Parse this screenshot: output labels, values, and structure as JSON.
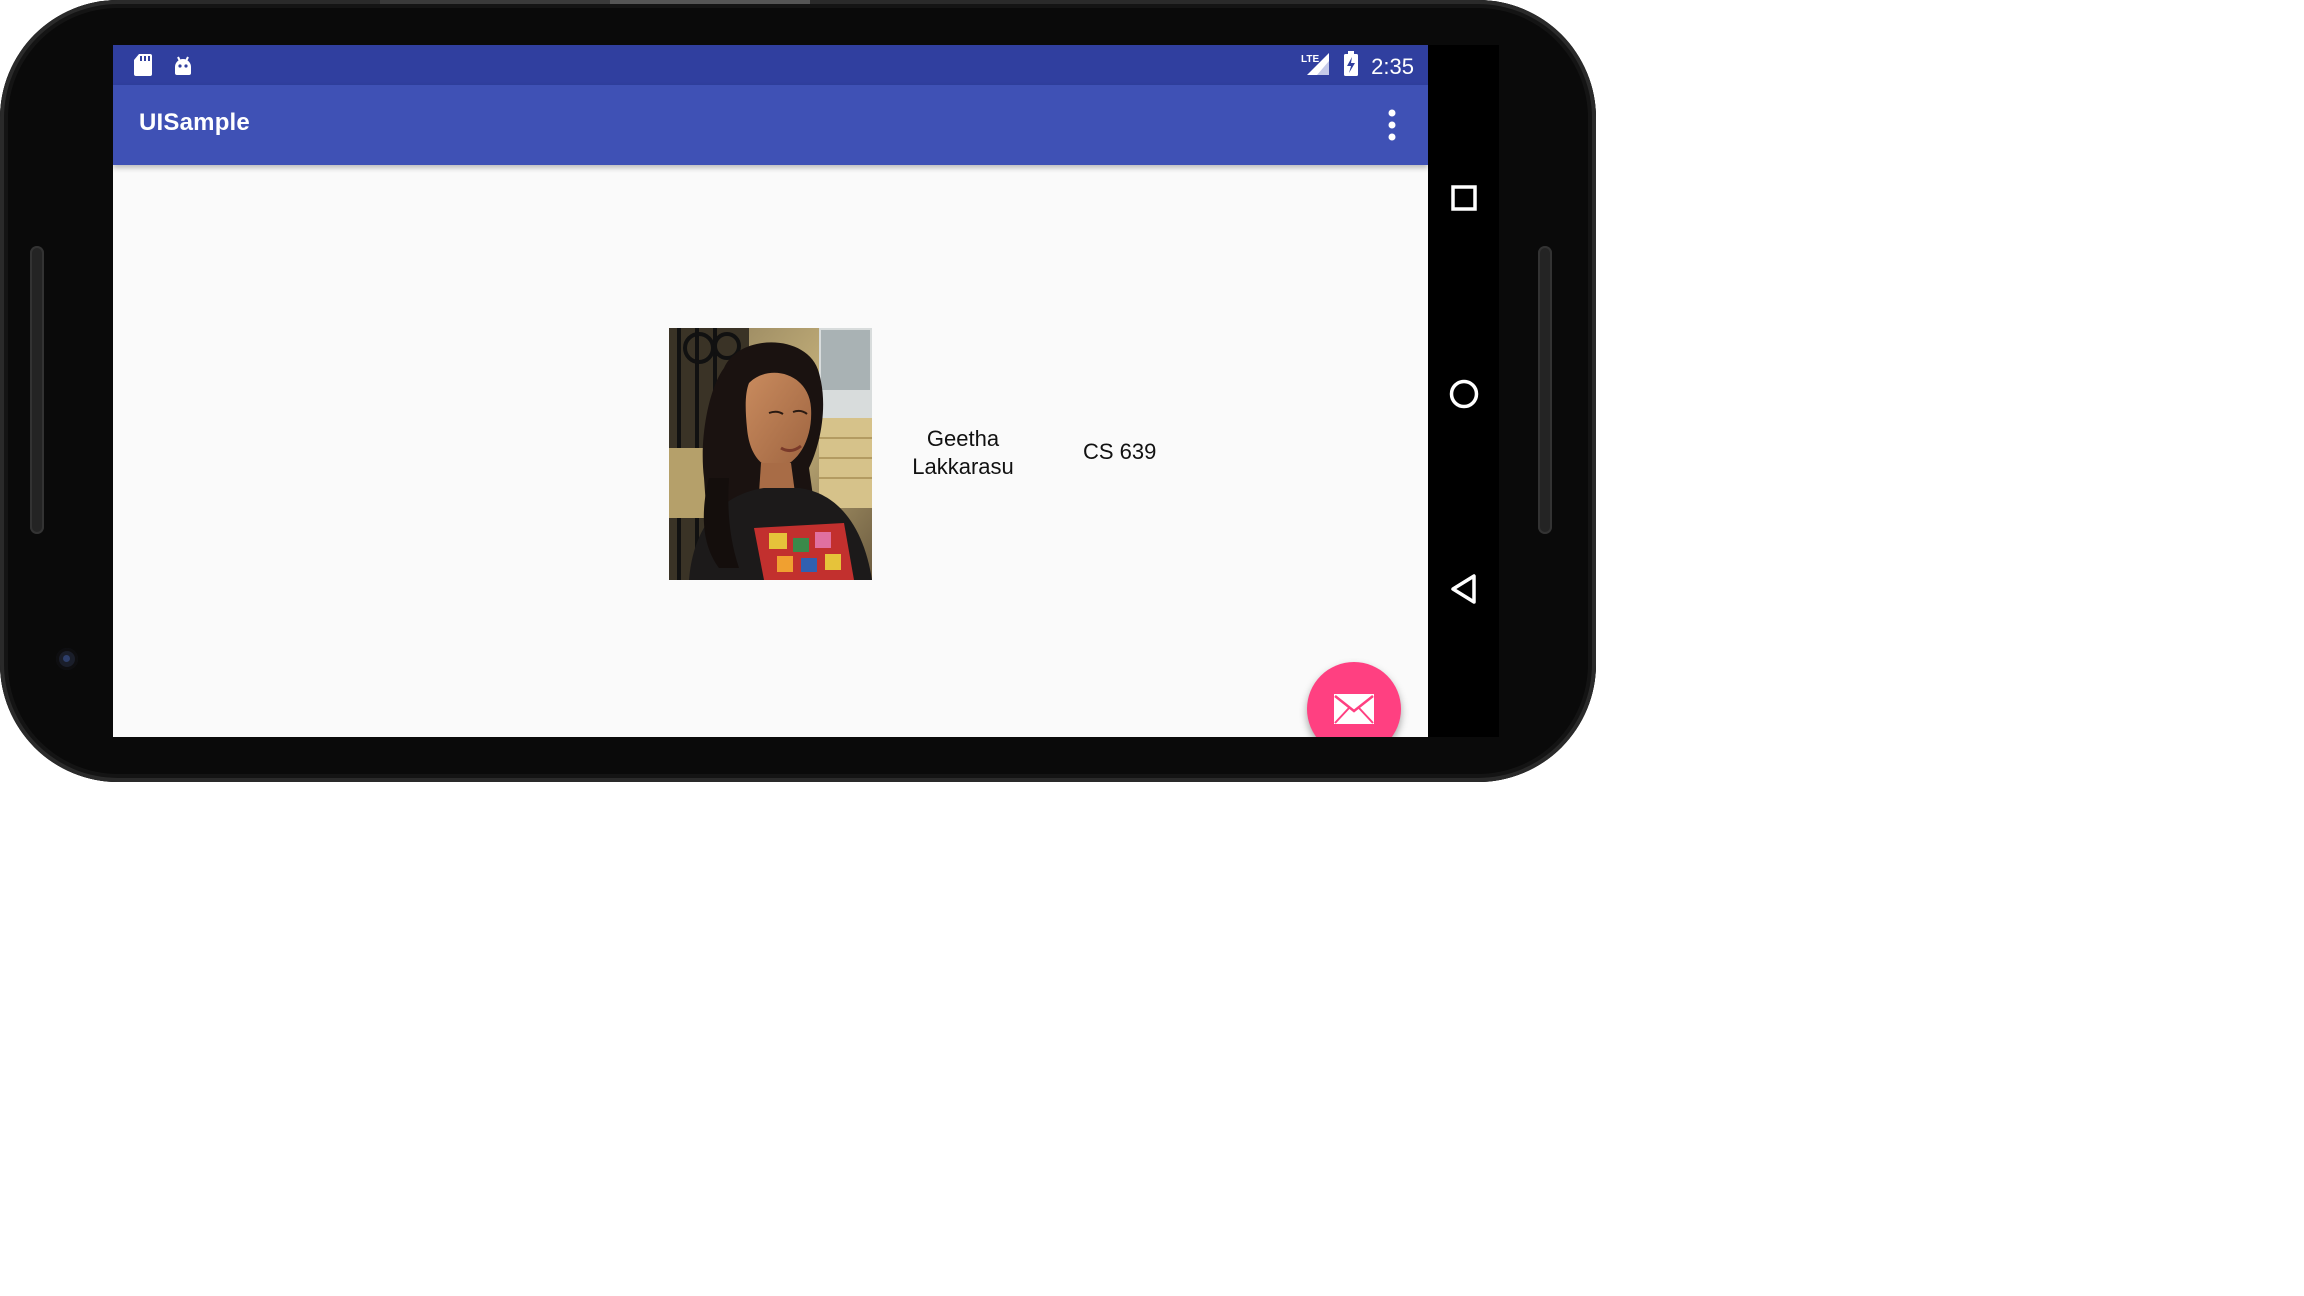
{
  "status_bar": {
    "time": "2:35",
    "icons": [
      "sd-card-icon",
      "android-debug-icon",
      "lte-signal-icon",
      "battery-charging-icon"
    ],
    "color": "#303f9f"
  },
  "app_bar": {
    "title": "UISample",
    "color": "#3f51b5",
    "menu_icon": "overflow-menu-icon"
  },
  "content": {
    "photo": "profile-photo",
    "name": "Geetha Lakkarasu",
    "name_line1": "Geetha",
    "name_line2": "Lakkarasu",
    "course": "CS 639"
  },
  "fab": {
    "icon": "mail-icon",
    "color": "#ff4081"
  },
  "nav_bar": {
    "buttons": [
      "recents-icon",
      "home-icon",
      "back-icon"
    ]
  }
}
